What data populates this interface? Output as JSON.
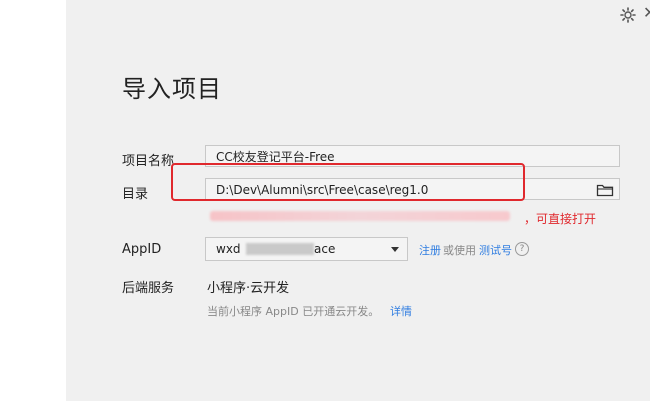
{
  "dialog": {
    "title": "导入项目",
    "icons": {
      "settings": "gear-icon",
      "close": "close-icon",
      "folder": "folder-icon",
      "help": "question-circle-icon",
      "dropdown": "chevron-down-icon"
    }
  },
  "form": {
    "project_name": {
      "label": "项目名称",
      "value": "CC校友登记平台-Free"
    },
    "directory": {
      "label": "目录",
      "value": "D:\\Dev\\Alumni\\src\\Free\\case\\reg1.0",
      "hint_tail": "，可直接打开"
    },
    "appid": {
      "label": "AppID",
      "value_prefix": "wxd",
      "value_suffix": "ace",
      "register_link": "注册",
      "or_use_text": "或使用",
      "test_account_link": "测试号"
    },
    "backend": {
      "label": "后端服务",
      "value": "小程序·云开发",
      "note": "当前小程序 AppID 已开通云开发。",
      "details_link": "详情"
    }
  },
  "colors": {
    "highlight": "#e0282d",
    "link": "#2f7de1",
    "panel_bg": "#f0f0f0"
  }
}
